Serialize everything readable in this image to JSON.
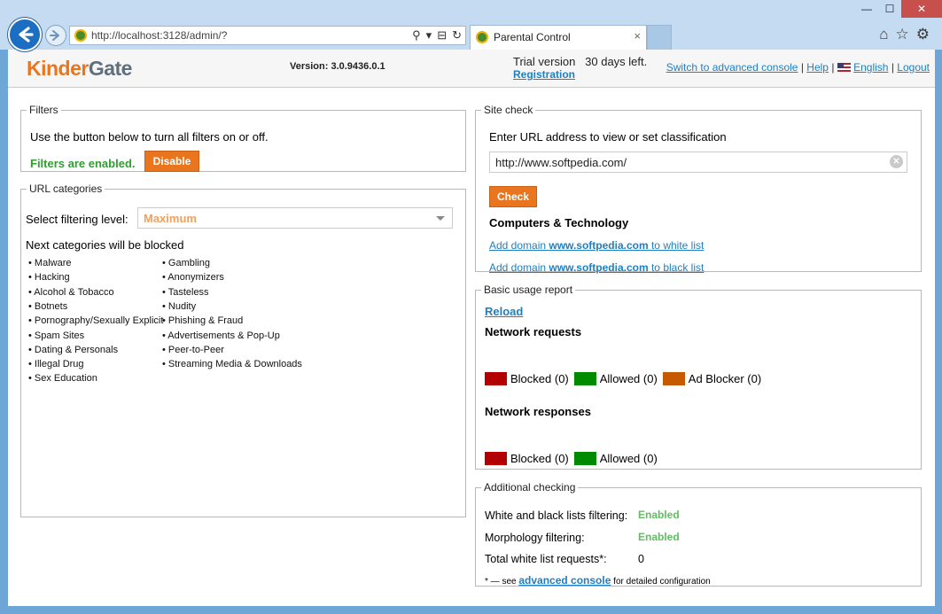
{
  "browser": {
    "url": "http://localhost:3128/admin/?",
    "tab_title": "Parental Control",
    "tab_close": "×",
    "win_minimize": "—",
    "win_maximize": "☐",
    "win_close": "✕",
    "addr_tools": {
      "search": "⚲",
      "dropdown": "▾",
      "compat": "⊟",
      "refresh": "↻"
    },
    "tools": {
      "home": "⌂",
      "favorites": "☆",
      "settings": "⚙"
    }
  },
  "header": {
    "logo_kinder": "Kinder",
    "logo_gate": "Gate",
    "version": "Version: 3.0.9436.0.1",
    "trial": "Trial version   30 days left.",
    "registration": "Registration",
    "links": {
      "advanced_console": "Switch to advanced console",
      "help": "Help",
      "language": "English",
      "logout": "Logout",
      "sep": "|"
    }
  },
  "filters": {
    "legend": "Filters",
    "description": "Use the button below to turn all filters on or off.",
    "status": "Filters are enabled.",
    "button": "Disable"
  },
  "url_categories": {
    "legend": "URL categories",
    "level_label": "Select filtering level:",
    "level_value": "Maximum",
    "blocked_heading": "Next categories will be blocked",
    "column1": [
      "• Malware",
      "• Hacking",
      "• Alcohol & Tobacco",
      "• Botnets",
      "• Pornography/Sexually Explicit",
      "• Spam Sites",
      "• Dating & Personals",
      "• Illegal Drug",
      "• Sex Education"
    ],
    "column2": [
      "• Gambling",
      "• Anonymizers",
      "• Tasteless",
      "• Nudity",
      "• Phishing & Fraud",
      "• Advertisements & Pop-Up",
      "• Peer-to-Peer",
      "• Streaming Media & Downloads"
    ]
  },
  "site_check": {
    "legend": "Site check",
    "prompt": "Enter URL address to view or set classification",
    "url_value": "http://www.softpedia.com/",
    "clear": "✕",
    "button": "Check",
    "category": "Computers & Technology",
    "white_prefix": "Add domain ",
    "white_domain": "www.softpedia.com",
    "white_suffix": " to white list",
    "black_prefix": "Add domain ",
    "black_domain": "www.softpedia.com",
    "black_suffix": " to black list"
  },
  "usage_report": {
    "legend": "Basic usage report",
    "reload": "Reload",
    "requests_title": "Network requests",
    "requests_legend": [
      {
        "label": "Blocked (0)",
        "color": "#b30000"
      },
      {
        "label": "Allowed (0)",
        "color": "#008a00"
      },
      {
        "label": "Ad Blocker (0)",
        "color": "#c65a00"
      }
    ],
    "responses_title": "Network responses",
    "responses_legend": [
      {
        "label": "Blocked (0)",
        "color": "#b30000"
      },
      {
        "label": "Allowed (0)",
        "color": "#008a00"
      }
    ]
  },
  "additional": {
    "legend": "Additional checking",
    "rows": [
      {
        "label": "White and black lists filtering:",
        "value": "Enabled"
      },
      {
        "label": "Morphology filtering:",
        "value": "Enabled"
      },
      {
        "label": "Total white list requests*:",
        "value": "0"
      }
    ],
    "note_prefix": "* — see ",
    "note_link": "advanced console",
    "note_suffix": " for detailed configuration"
  }
}
